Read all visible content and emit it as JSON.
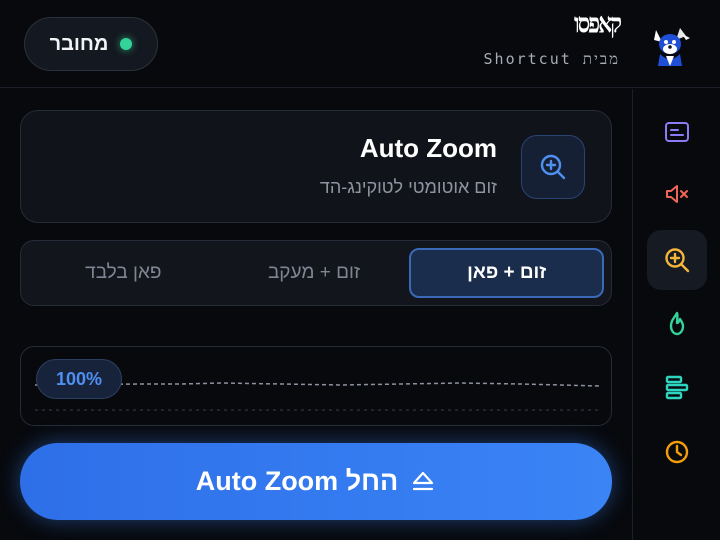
{
  "header": {
    "status": {
      "label": "מחובר",
      "color": "#34d399"
    },
    "brand": {
      "logo_text": "קאפסו",
      "subtitle_he": "מבית",
      "subtitle_en": "Shortcut"
    }
  },
  "card": {
    "title": "Auto Zoom",
    "description": "זום אוטומטי לטוקינג-הד",
    "icon": "zoom-in-icon"
  },
  "modes": {
    "selected": "זום + פאן",
    "items": [
      "זום + פאן",
      "זום + מעקב",
      "פאן בלבד"
    ]
  },
  "zoom_preview": {
    "level": "100%"
  },
  "start_button": {
    "label": "החל Auto Zoom",
    "icon": "eject-icon"
  },
  "sidebar": {
    "items": [
      {
        "icon": "subtitles-icon",
        "color": "#8b7cf6",
        "active": false
      },
      {
        "icon": "mute-icon",
        "color": "#f0655a",
        "active": false
      },
      {
        "icon": "zoom-in-icon",
        "color": "#f5b53a",
        "active": true
      },
      {
        "icon": "flame-icon",
        "color": "#34d399",
        "active": false
      },
      {
        "icon": "layout-bars-icon",
        "color": "#2dd4bf",
        "active": false
      },
      {
        "icon": "clock-icon",
        "color": "#f59e0b",
        "active": false
      }
    ]
  },
  "colors": {
    "accent": "#3b82f6",
    "background": "#07090d"
  }
}
